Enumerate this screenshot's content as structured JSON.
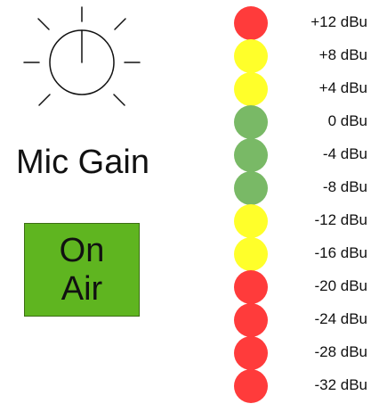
{
  "knob": {
    "label": "Mic Gain",
    "icon": "rotary-knob-icon"
  },
  "on_air_button": {
    "line1": "On",
    "line2": "Air",
    "color": "#5fb520"
  },
  "meter": {
    "levels": [
      {
        "label": "+12 dBu",
        "color": "#ff3b3b"
      },
      {
        "label": "+8 dBu",
        "color": "#ffff2a"
      },
      {
        "label": "+4 dBu",
        "color": "#ffff2a"
      },
      {
        "label": "0 dBu",
        "color": "#79b966"
      },
      {
        "label": "-4 dBu",
        "color": "#79b966"
      },
      {
        "label": "-8 dBu",
        "color": "#79b966"
      },
      {
        "label": "-12 dBu",
        "color": "#ffff2a"
      },
      {
        "label": "-16 dBu",
        "color": "#ffff2a"
      },
      {
        "label": "-20 dBu",
        "color": "#ff3b3b"
      },
      {
        "label": "-24 dBu",
        "color": "#ff3b3b"
      },
      {
        "label": "-28 dBu",
        "color": "#ff3b3b"
      },
      {
        "label": "-32 dBu",
        "color": "#ff3b3b"
      }
    ]
  }
}
